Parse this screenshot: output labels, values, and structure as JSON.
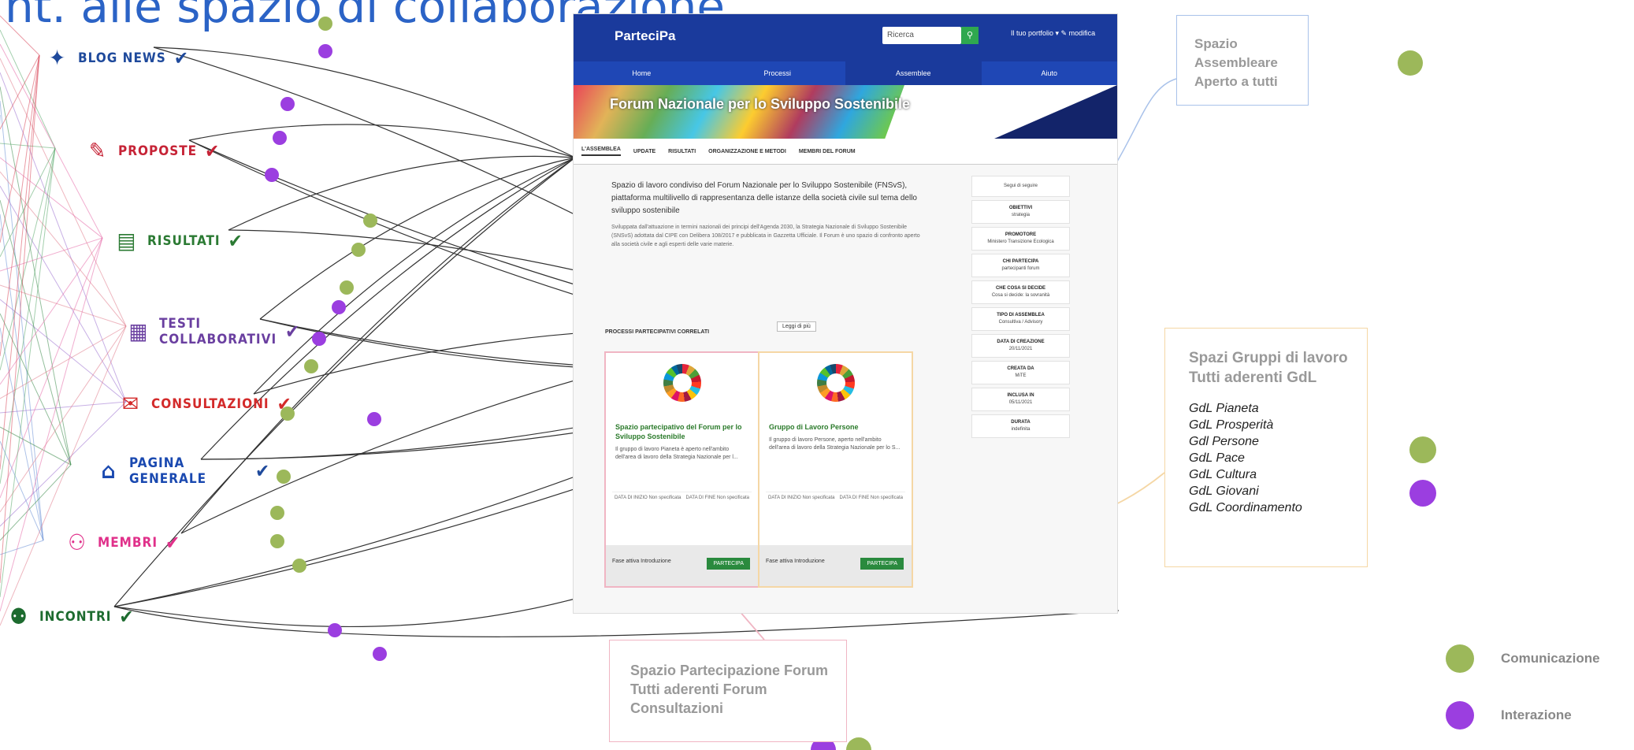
{
  "title": "nt. alle spazio di collaborazione",
  "categories": [
    {
      "label": "BLOG NEWS",
      "color": "#1f4a9c"
    },
    {
      "label": "PROPOSTE",
      "color": "#c62336"
    },
    {
      "label": "RISULTATI",
      "color": "#2b7a33"
    },
    {
      "label": "TESTI COLLABORATIVI",
      "color": "#6a3fa0"
    },
    {
      "label": "CONSULTAZIONI",
      "color": "#d32a2a"
    },
    {
      "label": "PAGINA GENERALE",
      "color": "#1a49b0"
    },
    {
      "label": "MEMBRI",
      "color": "#e0308a"
    },
    {
      "label": "INCONTRI",
      "color": "#1d6b2f"
    }
  ],
  "site": {
    "logo": "ParteciPa",
    "search_placeholder": "Ricerca",
    "user": "Il tuo portfolio ▾ ✎ modifica",
    "nav": [
      "Home",
      "Processi",
      "Assemblee",
      "Aiuto"
    ],
    "hero_title": "Forum Nazionale per lo Sviluppo Sostenibile",
    "tabs": [
      "L'assemblea",
      "Update",
      "Risultati",
      "Organizzazione e metodi",
      "Membri del forum"
    ],
    "lead": "Spazio di lavoro condiviso del Forum Nazionale per lo Sviluppo Sostenibile (FNSvS), piattaforma multilivello di rappresentanza delle istanze della società civile sul tema dello sviluppo sostenibile",
    "small": "Sviluppata dall'attuazione in termini nazionali dei principi dell'Agenda 2030, la Strategia Nazionale di Sviluppo Sostenibile (SNSvS) adottata dal CIPE con Delibera 108/2017 e pubblicata in Gazzetta Ufficiale. Il Forum è uno spazio di confronto aperto alla società civile e agli esperti delle varie materie.",
    "read_more": "Leggi di più",
    "side": [
      {
        "k": "OBIETTIVI",
        "v": "strategia"
      },
      {
        "k": "PROMOTORE",
        "v": "Ministero Transizione Ecologica"
      },
      {
        "k": "CHI PARTECIPA",
        "v": "partecipanti forum"
      },
      {
        "k": "CHE COSA SI DECIDE",
        "v": "Cosa si decide: la sovranità"
      },
      {
        "k": "TIPO DI ASSEMBLEA",
        "v": "Consultiva / Advisory"
      },
      {
        "k": "DATA DI CREAZIONE",
        "v": "20/11/2021"
      },
      {
        "k": "CREATA DA",
        "v": "MiTE"
      },
      {
        "k": "INCLUSA IN",
        "v": "05/11/2021"
      },
      {
        "k": "DURATA",
        "v": "indefinita"
      }
    ],
    "follow": "Segui di seguire",
    "procs_title": "PROCESSI PARTECIPATIVI CORRELATI",
    "cards": [
      {
        "title": "Spazio partecipativo del Forum per lo Sviluppo Sostenibile",
        "desc": "Il gruppo di lavoro Pianeta è aperto nell'ambito dell'area di lavoro della Strategia Nazionale per l...",
        "meta": [
          "DATA DI INIZIO Non specificata",
          "DATA DI FINE Non specificata"
        ],
        "foot": "Fase attiva Introduzione",
        "btn": "PARTECIPA"
      },
      {
        "title": "Gruppo di Lavoro Persone",
        "desc": "Il gruppo di lavoro Persone, aperto nell'ambito dell'area di lavoro della Strategia Nazionale per lo S...",
        "meta": [
          "DATA DI INIZIO Non specificata",
          "DATA DI FINE Non specificata"
        ],
        "foot": "Fase attiva Introduzione",
        "btn": "PARTECIPA"
      }
    ]
  },
  "boxes": {
    "assembleare": "Spazio Assembleare\nAperto a tutti",
    "gruppi": "Spazi Gruppi di lavoro\nTutti aderenti GdL",
    "gdl_list": [
      "GdL Pianeta",
      "GdL Prosperità",
      "Gdl Persone",
      "GdL Pace",
      "GdL Cultura",
      "GdL Giovani",
      "GdL Coordinamento"
    ],
    "partecipazione": "Spazio Partecipazione Forum\nTutti aderenti Forum\nConsultazioni"
  },
  "legend": [
    {
      "label": "Comunicazione",
      "color": "#9cb85a"
    },
    {
      "label": "Interazione",
      "color": "#9b3ee0"
    }
  ],
  "colors": {
    "green": "#9cb85a",
    "purple": "#9b3ee0",
    "blue_box": "#a9c2ea",
    "orange_box": "#f5d7a5",
    "pink_box": "#f0b5c3"
  }
}
